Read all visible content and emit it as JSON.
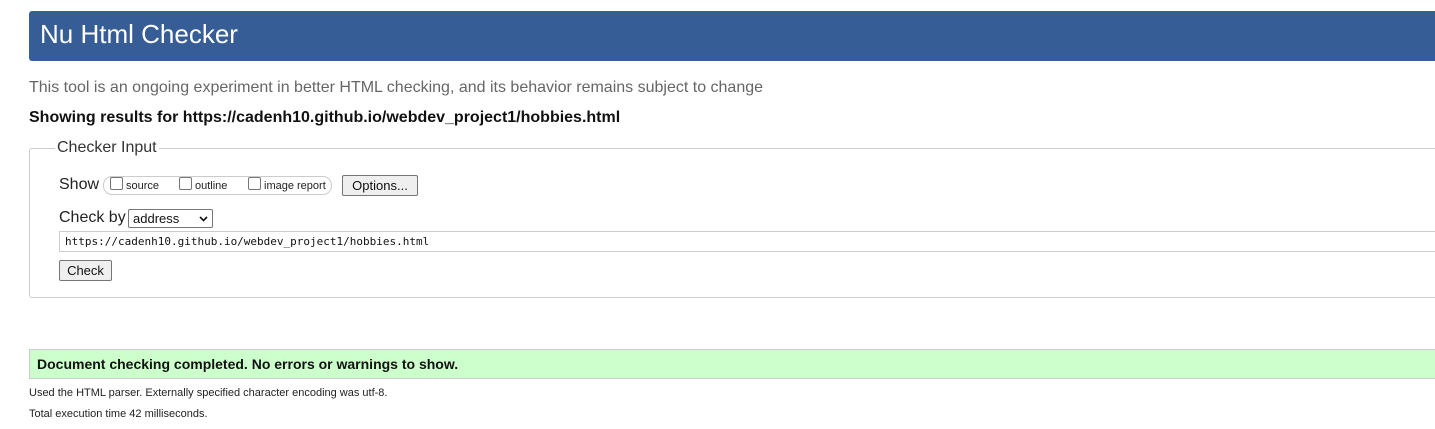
{
  "header": {
    "title": "Nu Html Checker"
  },
  "subtitle": "This tool is an ongoing experiment in better HTML checking, and its behavior remains subject to change",
  "results_for": "Showing results for https://cadenh10.github.io/webdev_project1/hobbies.html",
  "checker_input": {
    "legend": "Checker Input",
    "show_label": "Show",
    "options": [
      {
        "label": "source",
        "checked": false
      },
      {
        "label": "outline",
        "checked": false
      },
      {
        "label": "image report",
        "checked": false
      }
    ],
    "options_button": "Options...",
    "check_by_label": "Check by",
    "check_by_selected": "address",
    "url_value": "https://cadenh10.github.io/webdev_project1/hobbies.html",
    "check_button": "Check"
  },
  "result": {
    "message": "Document checking completed. No errors or warnings to show.",
    "color": "#ccffcc"
  },
  "details": {
    "parser": "Used the HTML parser. Externally specified character encoding was utf-8.",
    "execution_time": "Total execution time 42 milliseconds."
  },
  "colors": {
    "header_bg": "#365d95",
    "header_text": "#ffffff",
    "subtitle_text": "#666666"
  },
  "icons": {
    "select_arrow": "chevron-down-icon"
  }
}
